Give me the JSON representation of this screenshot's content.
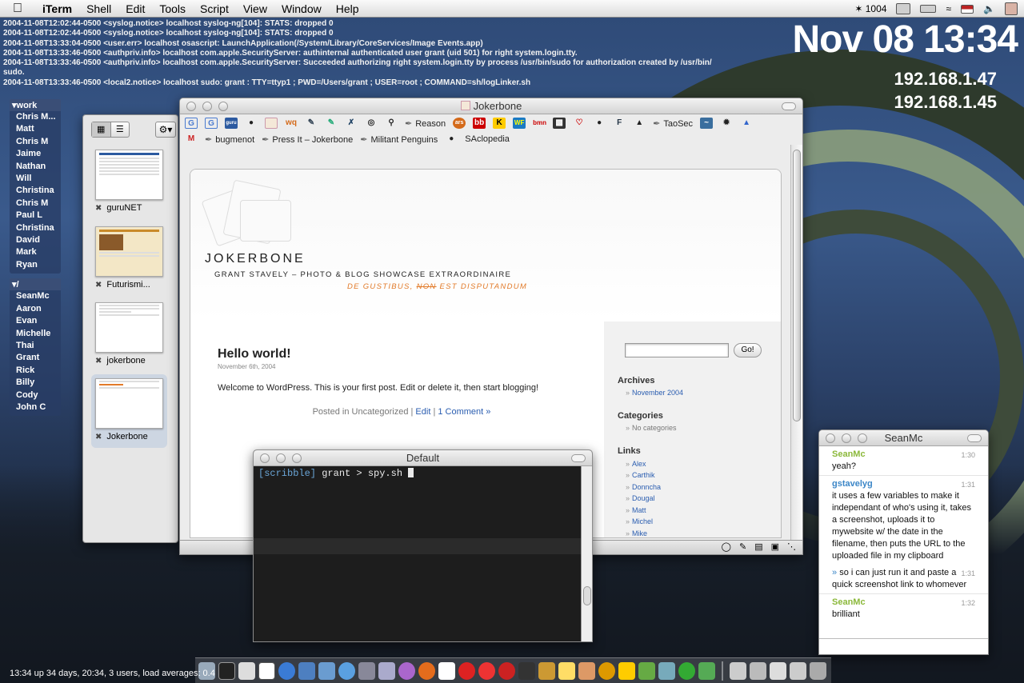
{
  "menubar": {
    "app_name": "iTerm",
    "items": [
      "Shell",
      "Edit",
      "Tools",
      "Script",
      "View",
      "Window",
      "Help"
    ],
    "status_number": "1004"
  },
  "console": {
    "lines": [
      "2004-11-08T12:02:44-0500 <syslog.notice> localhost syslog-ng[104]: STATS: dropped 0",
      "2004-11-08T12:02:44-0500 <syslog.notice> localhost syslog-ng[104]: STATS: dropped 0",
      "2004-11-08T13:33:04-0500 <user.err> localhost osascript: LaunchApplication(/System/Library/CoreServices/Image Events.app)",
      "2004-11-08T13:33:46-0500 <authpriv.info> localhost com.apple.SecurityServer: authinternal authenticated user grant (uid 501) for right system.login.tty.",
      "2004-11-08T13:33:46-0500 <authpriv.info> localhost com.apple.SecurityServer: Succeeded authorizing right system.login.tty by process /usr/bin/sudo for authorization created by /usr/bin/",
      "sudo.",
      "2004-11-08T13:33:46-0500 <local2.notice> localhost sudo:    grant : TTY=ttyp1 ; PWD=/Users/grant ; USER=root ; COMMAND=sh/logLinker.sh"
    ]
  },
  "clock": "Nov 08 13:34",
  "ips": [
    "192.168.1.47",
    "192.168.1.45"
  ],
  "uptime": "13:34  up 34 days, 20:34, 3 users, load averages: 0.4",
  "buddies": {
    "group1": "work",
    "group1_items": [
      "Chris M...",
      "Matt",
      "Chris M",
      "Jaime",
      "Nathan",
      "Will",
      "Christina",
      "Chris M",
      "Paul L",
      "Christina",
      "David",
      "Mark",
      "Ryan"
    ],
    "group2": "/",
    "group2_items": [
      "SeanMc",
      "Aaron",
      "Evan",
      "Michelle",
      "Thai",
      "Grant",
      "Rick",
      "Billy",
      "Cody",
      "John C"
    ]
  },
  "tabs": {
    "items": [
      {
        "label": "guruNET"
      },
      {
        "label": "Futurismi..."
      },
      {
        "label": "jokerbone"
      },
      {
        "label": "Jokerbone"
      }
    ]
  },
  "browser": {
    "title": "Jokerbone",
    "bookmarks_row1": [
      "Reason",
      "TaoSec"
    ],
    "bookmarks_row2": [
      "bugmenot",
      "Press It – Jokerbone",
      "Militant Penguins",
      "SAclopedia"
    ],
    "site_title": "JOKERBONE",
    "site_sub": "GRANT STAVELY – PHOTO & BLOG SHOWCASE EXTRAORDINAIRE",
    "motto_a": "DE GUSTIBUS, ",
    "motto_b": "NON",
    "motto_c": " EST DISPUTANDUM",
    "post_title": "Hello world!",
    "post_date": "November 6th, 2004",
    "post_body": "Welcome to WordPress. This is your first post. Edit or delete it, then start blogging!",
    "post_meta_prefix": "Posted in Uncategorized | ",
    "post_edit": "Edit",
    "post_sep": " | ",
    "post_comments": "1 Comment »",
    "go_label": "Go!",
    "archives_h": "Archives",
    "archives_item": "November 2004",
    "categories_h": "Categories",
    "categories_item": "No categories",
    "links_h": "Links",
    "links": [
      "Alex",
      "Carthik",
      "Donncha",
      "Dougal",
      "Matt",
      "Michel",
      "Mike"
    ]
  },
  "terminal": {
    "title": "Default",
    "prompt_host": "[scribble]",
    "prompt_user": " grant > ",
    "command": "spy.sh "
  },
  "chat": {
    "title": "SeanMc",
    "messages": [
      {
        "who": "SeanMc",
        "time": "1:30",
        "text": "yeah?"
      },
      {
        "who": "gstavelyg",
        "time": "1:31",
        "text": "it uses a few variables to make it independant of who's using it, takes a screenshot, uploads it to mywebsite w/ the date in the filename, then puts the URL to the uploaded file in my clipboard"
      },
      {
        "who": "",
        "time": "1:31",
        "text": "so i can just run it and paste a quick screenshot link to whomever"
      },
      {
        "who": "SeanMc",
        "time": "1:32",
        "text": "brilliant"
      }
    ]
  }
}
